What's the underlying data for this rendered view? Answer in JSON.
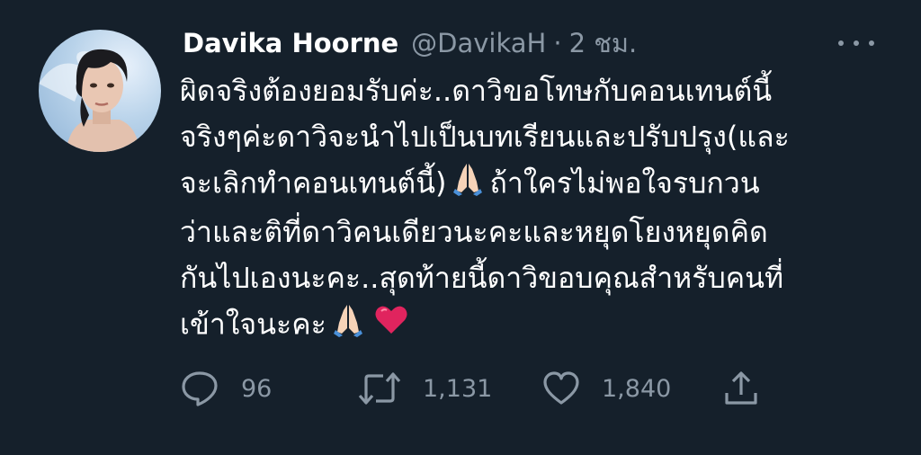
{
  "tweet": {
    "display_name": "Davika Hoorne",
    "handle": "@DavikaH",
    "separator": "·",
    "time": "2 ชม.",
    "body_lines": [
      "ผิดจริงต้องยอมรับค่ะ..ดาวิขอโทษกับคอนเทนต์นี้",
      "จริงๆค่ะดาวิจะนำไปเป็นบทเรียนและปรับปรุง(และ",
      "จะเลิกทำคอนเทนต์นี้)",
      "ถ้าใครไม่พอใจรบกวน",
      "ว่าและติที่ดาวิคนเดียวนะคะและหยุดโยงหยุดคิด",
      "กันไปเองนะคะ..สุดท้ายนี้ดาวิขอบคุณสำหรับคนที่",
      "เข้าใจนะคะ"
    ],
    "emojis": [
      "folded-hands",
      "folded-hands",
      "red-heart"
    ]
  },
  "actions": {
    "reply_count": "96",
    "retweet_count": "1,131",
    "like_count": "1,840"
  },
  "icons": [
    "more-icon",
    "reply-icon",
    "retweet-icon",
    "like-icon",
    "share-icon"
  ],
  "colors": {
    "background": "#15202b",
    "text": "#ffffff",
    "secondary": "#8b98a5",
    "heart": "#e0245e"
  }
}
